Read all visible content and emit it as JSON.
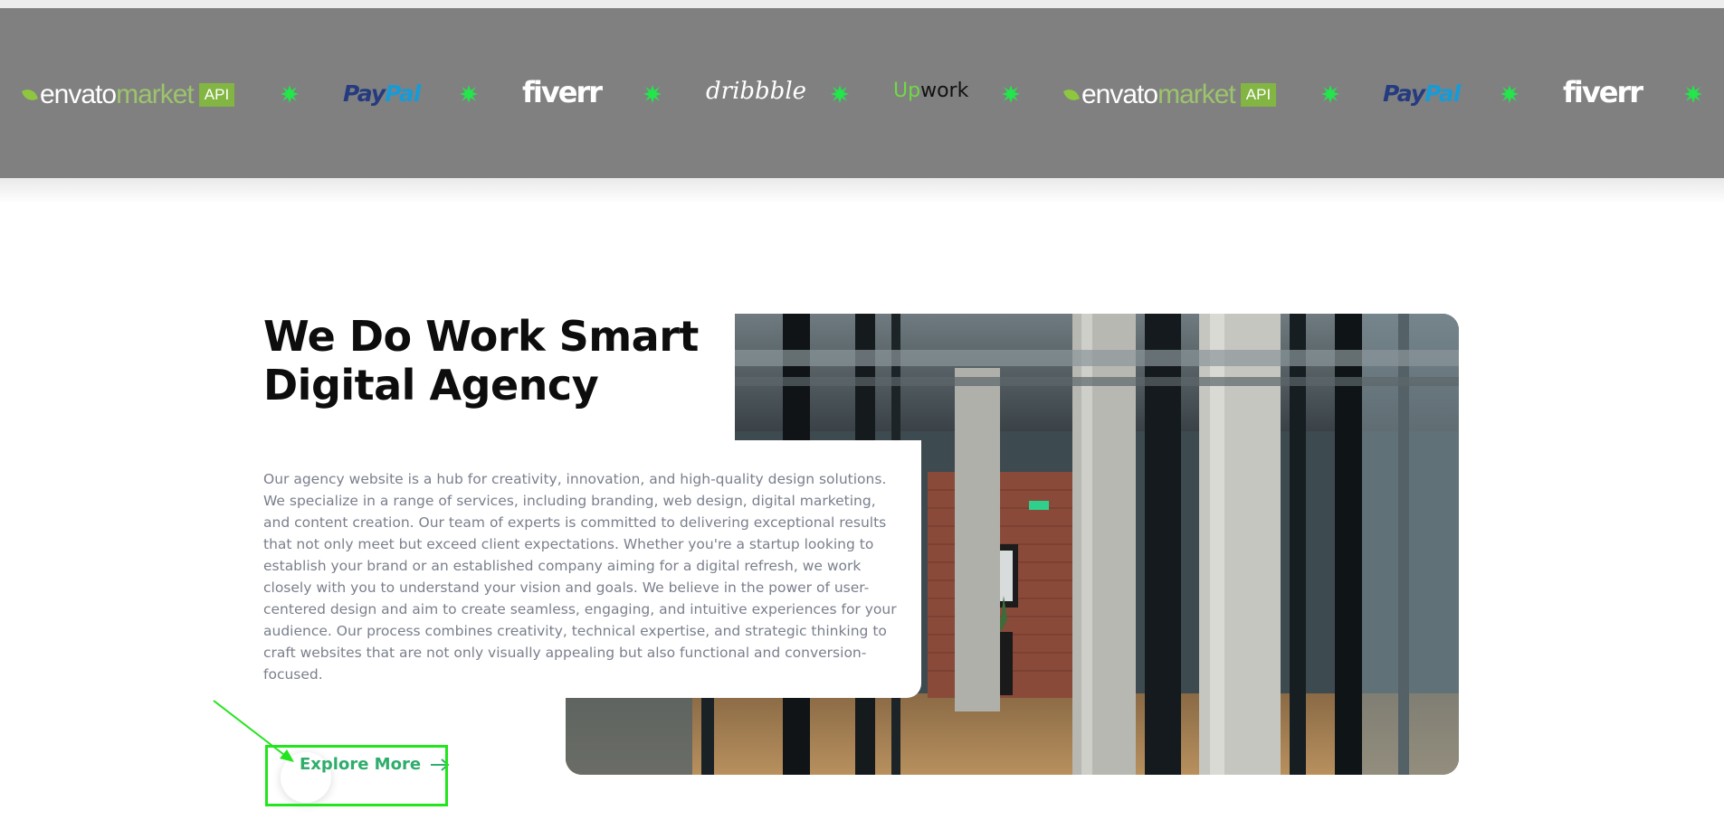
{
  "logo_band": {
    "logos": [
      {
        "name": "envato",
        "word": "envato",
        "suffix": "market",
        "badge": "API"
      },
      {
        "name": "paypal",
        "part1": "Pay",
        "part2": "Pal"
      },
      {
        "name": "fiverr",
        "text": "fiverr"
      },
      {
        "name": "dribbble",
        "text": "dribbble"
      },
      {
        "name": "upwork",
        "part1": "Up",
        "part2": "work"
      },
      {
        "name": "envato",
        "word": "envato",
        "suffix": "market",
        "badge": "API"
      },
      {
        "name": "paypal",
        "part1": "Pay",
        "part2": "Pal"
      },
      {
        "name": "fiverr",
        "text": "fiverr"
      }
    ],
    "separator_icon": "star-burst-icon",
    "separator_color": "#22e64a",
    "background": "#808080"
  },
  "hero": {
    "title_line1": "We Do Work Smart",
    "title_line2": "Digital Agency",
    "description": "Our agency website is a hub for creativity, innovation, and high-quality design solutions. We specialize in a range of services, including branding, web design, digital marketing, and content creation. Our team of experts is committed to delivering exceptional results that not only meet but exceed client expectations. Whether you're a startup looking to establish your brand or an established company aiming for a digital refresh, we work closely with you to understand your vision and goals. We believe in the power of user-centered design and aim to create seamless, engaging, and intuitive experiences for your audience. Our process combines creativity, technical expertise, and strategic thinking to craft websites that are not only visually appealing but also functional and conversion-focused.",
    "button_label": "Explore More",
    "button_icon": "arrow-right-icon",
    "accent": "#2ead6b",
    "image": "office-corridor-photo"
  },
  "annotation": {
    "color": "#22e51d",
    "icon": "pointer-arrow-icon"
  }
}
